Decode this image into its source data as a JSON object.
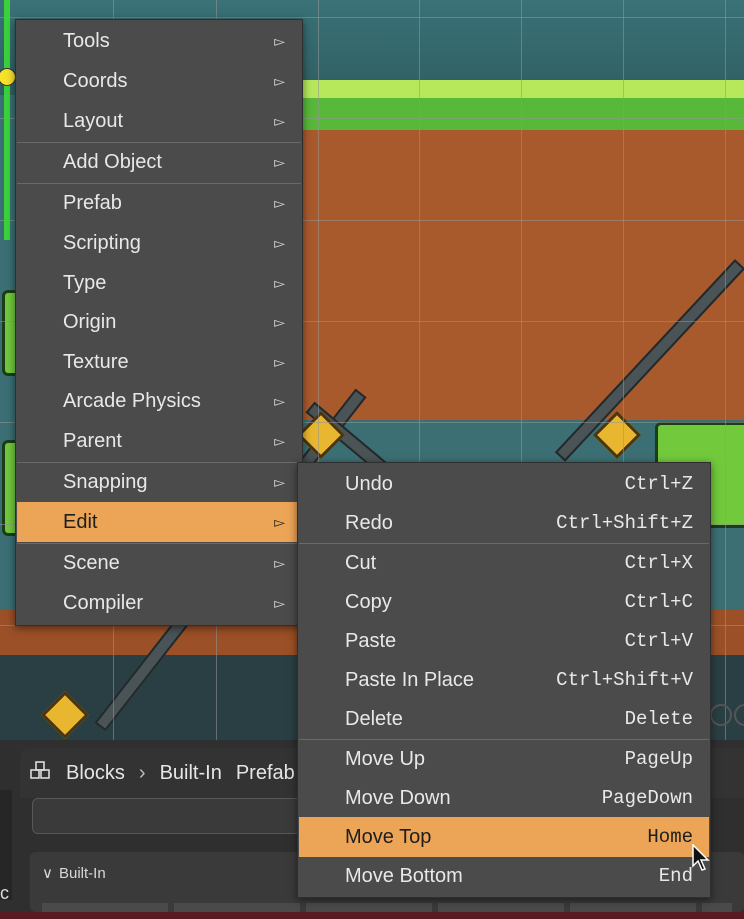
{
  "main_menu": {
    "items": [
      {
        "label": "Tools",
        "arrow": "▻"
      },
      {
        "label": "Coords",
        "arrow": "▻"
      },
      {
        "label": "Layout",
        "arrow": "▻"
      },
      {
        "label": "Add Object",
        "arrow": "▻"
      },
      {
        "label": "Prefab",
        "arrow": "▻"
      },
      {
        "label": "Scripting",
        "arrow": "▻"
      },
      {
        "label": "Type",
        "arrow": "▻"
      },
      {
        "label": "Origin",
        "arrow": "▻"
      },
      {
        "label": "Texture",
        "arrow": "▻"
      },
      {
        "label": "Arcade Physics",
        "arrow": "▻"
      },
      {
        "label": "Parent",
        "arrow": "▻"
      },
      {
        "label": "Snapping",
        "arrow": "▻"
      },
      {
        "label": "Edit",
        "arrow": "▻",
        "active": true
      },
      {
        "label": "Scene",
        "arrow": "▻"
      },
      {
        "label": "Compiler",
        "arrow": "▻"
      }
    ]
  },
  "edit_submenu": {
    "items": [
      {
        "label": "Undo",
        "shortcut": "Ctrl+Z"
      },
      {
        "label": "Redo",
        "shortcut": "Ctrl+Shift+Z"
      },
      {
        "label": "Cut",
        "shortcut": "Ctrl+X"
      },
      {
        "label": "Copy",
        "shortcut": "Ctrl+C"
      },
      {
        "label": "Paste",
        "shortcut": "Ctrl+V"
      },
      {
        "label": "Paste In Place",
        "shortcut": "Ctrl+Shift+V"
      },
      {
        "label": "Delete",
        "shortcut": "Delete"
      },
      {
        "label": "Move Up",
        "shortcut": "PageUp"
      },
      {
        "label": "Move Down",
        "shortcut": "PageDown"
      },
      {
        "label": "Move Top",
        "shortcut": "Home",
        "active": true
      },
      {
        "label": "Move Bottom",
        "shortcut": "End"
      }
    ]
  },
  "blocks_panel": {
    "breadcrumb": [
      "Blocks",
      "Built-In",
      "Prefab"
    ],
    "breadcrumb_sep": "›",
    "section_label": "Built-In",
    "section_chevron": "∨",
    "cut_letter": "c"
  },
  "colors": {
    "menu_bg": "#4b4b4b",
    "highlight": "#eca456",
    "text": "#e8e8e8"
  }
}
